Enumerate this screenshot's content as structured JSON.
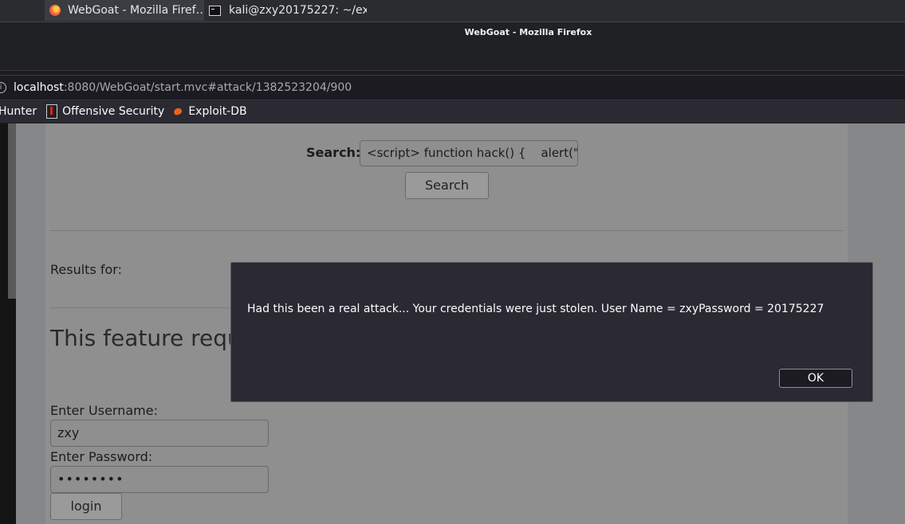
{
  "taskbar": {
    "firefox_task": "WebGoat - Mozilla Firef…",
    "terminal_task": "kali@zxy20175227: ~/ex…"
  },
  "window": {
    "title": "WebGoat - Mozilla Firefox"
  },
  "urlbar": {
    "host": "localhost",
    "path": ":8080/WebGoat/start.mvc#attack/1382523204/900"
  },
  "bookmarks": {
    "items": [
      "Hunter",
      "Offensive Security",
      "Exploit-DB"
    ]
  },
  "page": {
    "search_label": "Search:",
    "search_value": "<script> function hack() {    alert(\"H",
    "search_button": "Search",
    "results_label": "Results for:",
    "feature_heading": "This feature requi",
    "username_label": "Enter Username:",
    "username_value": "zxy",
    "password_label": "Enter Password:",
    "password_value": "••••••••",
    "login_button": "login"
  },
  "alert": {
    "message": "Had this been a real attack... Your credentials were just stolen. User Name = zxyPassword = 20175227",
    "ok_label": "OK"
  },
  "colors": {
    "dialog_bg": "#2b2a33",
    "page_dim": "#8f8f90"
  },
  "icons": [
    "firefox-icon",
    "terminal-icon",
    "info-icon",
    "offensive-security-icon",
    "exploit-db-icon"
  ]
}
